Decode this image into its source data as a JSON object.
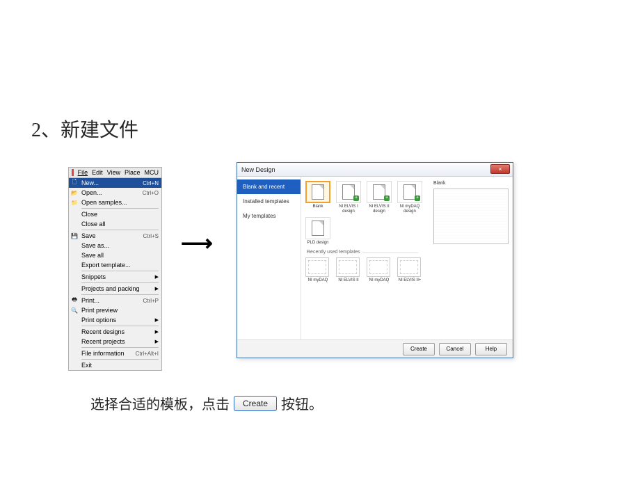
{
  "title": "2、新建文件",
  "arrow": "———→",
  "menubar": {
    "file": "File",
    "edit": "Edit",
    "view": "View",
    "place": "Place",
    "mcu": "MCU"
  },
  "menu": {
    "new": "New...",
    "new_sc": "Ctrl+N",
    "open": "Open...",
    "open_sc": "Ctrl+O",
    "open_samples": "Open samples...",
    "close": "Close",
    "close_all": "Close all",
    "save": "Save",
    "save_sc": "Ctrl+S",
    "save_as": "Save as...",
    "save_all": "Save all",
    "export_template": "Export template...",
    "snippets": "Snippets",
    "projects_packing": "Projects and packing",
    "print": "Print...",
    "print_sc": "Ctrl+P",
    "print_preview": "Print preview",
    "print_options": "Print options",
    "recent_designs": "Recent designs",
    "recent_projects": "Recent projects",
    "file_info": "File information",
    "file_info_sc": "Ctrl+Alt+I",
    "exit": "Exit"
  },
  "dialog": {
    "title": "New Design",
    "close_x": "×",
    "side": {
      "blank_recent": "Blank and recent",
      "installed": "Installed templates",
      "my": "My templates"
    },
    "templates": {
      "blank": "Blank",
      "elvis1": "NI ELVIS I design",
      "elvis2": "NI ELVIS II design",
      "mydaq": "NI myDAQ design",
      "pld": "PLD design"
    },
    "recent_label": "Recently used templates",
    "recent": {
      "r1": "NI myDAQ",
      "r2": "NI ELVIS II",
      "r3": "NI myDAQ",
      "r4": "NI ELVIS II+"
    },
    "preview_label": "Blank",
    "buttons": {
      "create": "Create",
      "cancel": "Cancel",
      "help": "Help"
    }
  },
  "instruction": {
    "before": "选择合适的模板，点击",
    "button": "Create",
    "after": "按钮。"
  }
}
